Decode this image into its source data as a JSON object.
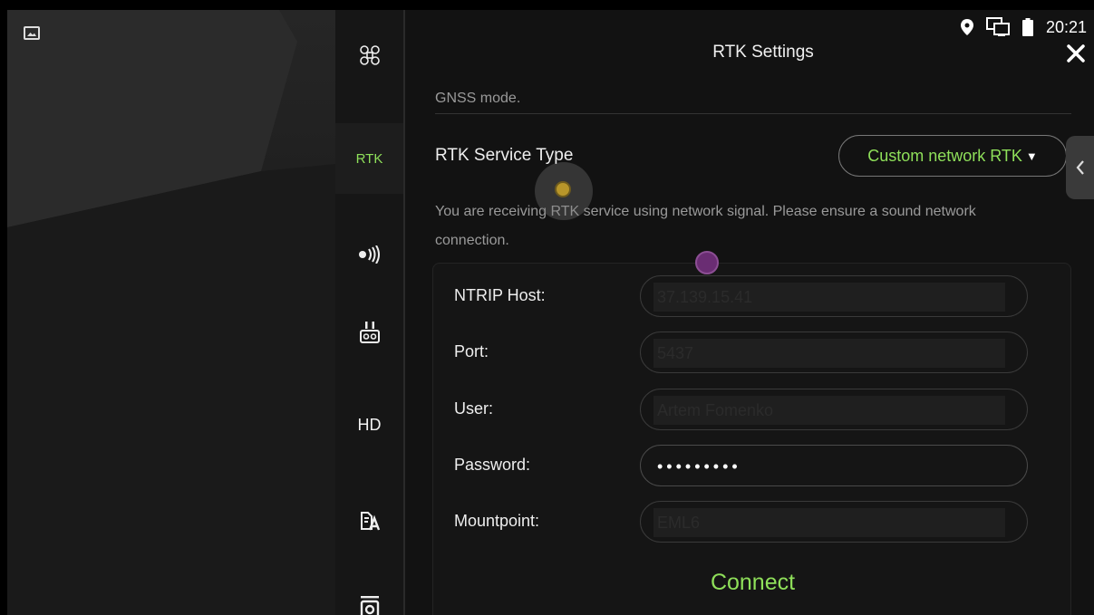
{
  "status_bar": {
    "time": "20:21"
  },
  "sidebar": {
    "items": [
      {
        "id": "aircraft",
        "label": ""
      },
      {
        "id": "rtk",
        "label": "RTK"
      },
      {
        "id": "signal",
        "label": ""
      },
      {
        "id": "remote",
        "label": ""
      },
      {
        "id": "hd",
        "label": "HD"
      },
      {
        "id": "general",
        "label": ""
      },
      {
        "id": "camera",
        "label": ""
      }
    ]
  },
  "panel": {
    "title": "RTK Settings",
    "clipped_text": "GNSS mode.",
    "service_type_label": "RTK Service Type",
    "service_type_value": "Custom network RTK",
    "service_type_caret": "▼",
    "description": "You are receiving RTK service using network signal. Please ensure a sound network connection.",
    "form": {
      "fields": [
        {
          "label": "NTRIP Host:",
          "value": "37.139.15.41"
        },
        {
          "label": "Port:",
          "value": "5437"
        },
        {
          "label": "User:",
          "value": "Artem Fomenko"
        },
        {
          "label": "Password:",
          "value": "•••••••••"
        },
        {
          "label": "Mountpoint:",
          "value": "EML6"
        }
      ],
      "connect_label": "Connect"
    }
  },
  "colors": {
    "accent": "#8fe05a",
    "background": "#121212"
  }
}
